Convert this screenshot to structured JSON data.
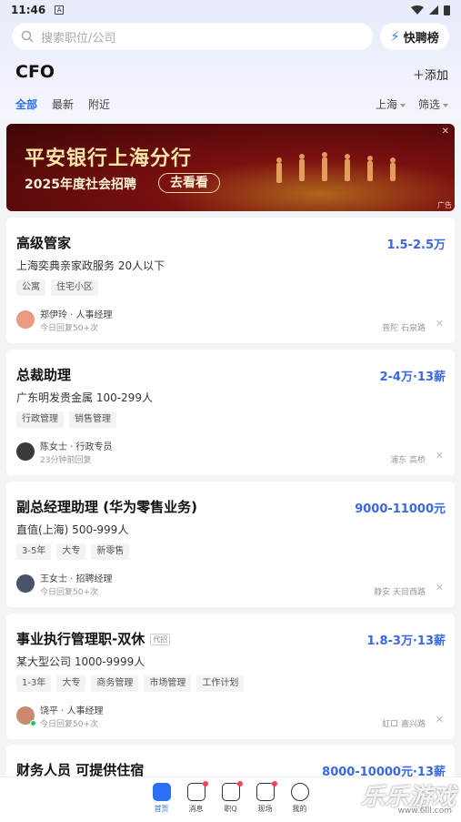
{
  "status": {
    "time": "11:46",
    "notif_icon": "A"
  },
  "search": {
    "placeholder": "搜索职位/公司"
  },
  "quick_button": {
    "label": "快聘榜"
  },
  "page_title": "CFO",
  "add_label": "添加",
  "tabs": [
    {
      "label": "全部"
    },
    {
      "label": "最新"
    },
    {
      "label": "附近"
    }
  ],
  "filters": {
    "city": "上海",
    "filter": "筛选"
  },
  "banner": {
    "title": "平安银行上海分行",
    "subtitle": "2025年度社会招聘",
    "cta": "去看看",
    "ad": "广告"
  },
  "jobs": [
    {
      "title": "高级管家",
      "salary": "1.5-2.5万",
      "company": "上海奕典亲家政服务  20人以下",
      "tags": [
        "公寓",
        "住宅小区"
      ],
      "recruiter": "郑伊玲 · 人事经理",
      "reply": "今日回复50+次",
      "location": "普陀 石泉路"
    },
    {
      "title": "总裁助理",
      "salary": "2-4万·13薪",
      "company": "广东明发贵金属  100-299人",
      "tags": [
        "行政管理",
        "销售管理"
      ],
      "recruiter": "陈女士 · 行政专员",
      "reply": "23分钟前回复",
      "location": "浦东 高桥"
    },
    {
      "title": "副总经理助理 (华为零售业务)",
      "salary": "9000-11000元",
      "company": "直值(上海)  500-999人",
      "tags": [
        "3-5年",
        "大专",
        "新零售"
      ],
      "recruiter": "王女士 · 招聘经理",
      "reply": "今日回复50+次",
      "location": "静安 天目西路"
    },
    {
      "title": "事业执行管理职-双休",
      "badge": "代招",
      "salary": "1.8-3万·13薪",
      "company": "某大型公司  1000-9999人",
      "tags": [
        "1-3年",
        "大专",
        "商务管理",
        "市场管理",
        "工作计划"
      ],
      "recruiter": "饶平 · 人事经理",
      "reply": "今日回复50+次",
      "location": "虹口 嘉兴路"
    },
    {
      "title": "财务人员 可提供住宿",
      "salary": "8000-10000元·13薪"
    }
  ],
  "nav": [
    {
      "label": "首页"
    },
    {
      "label": "消息"
    },
    {
      "label": "职Q"
    },
    {
      "label": "现场"
    },
    {
      "label": "我的"
    }
  ],
  "watermark": {
    "text": "乐乐游戏",
    "url": "www.6lll.com"
  },
  "colors": {
    "accent": "#2b6ff3",
    "salary": "#3a67e6",
    "banner": "#7a1010"
  }
}
